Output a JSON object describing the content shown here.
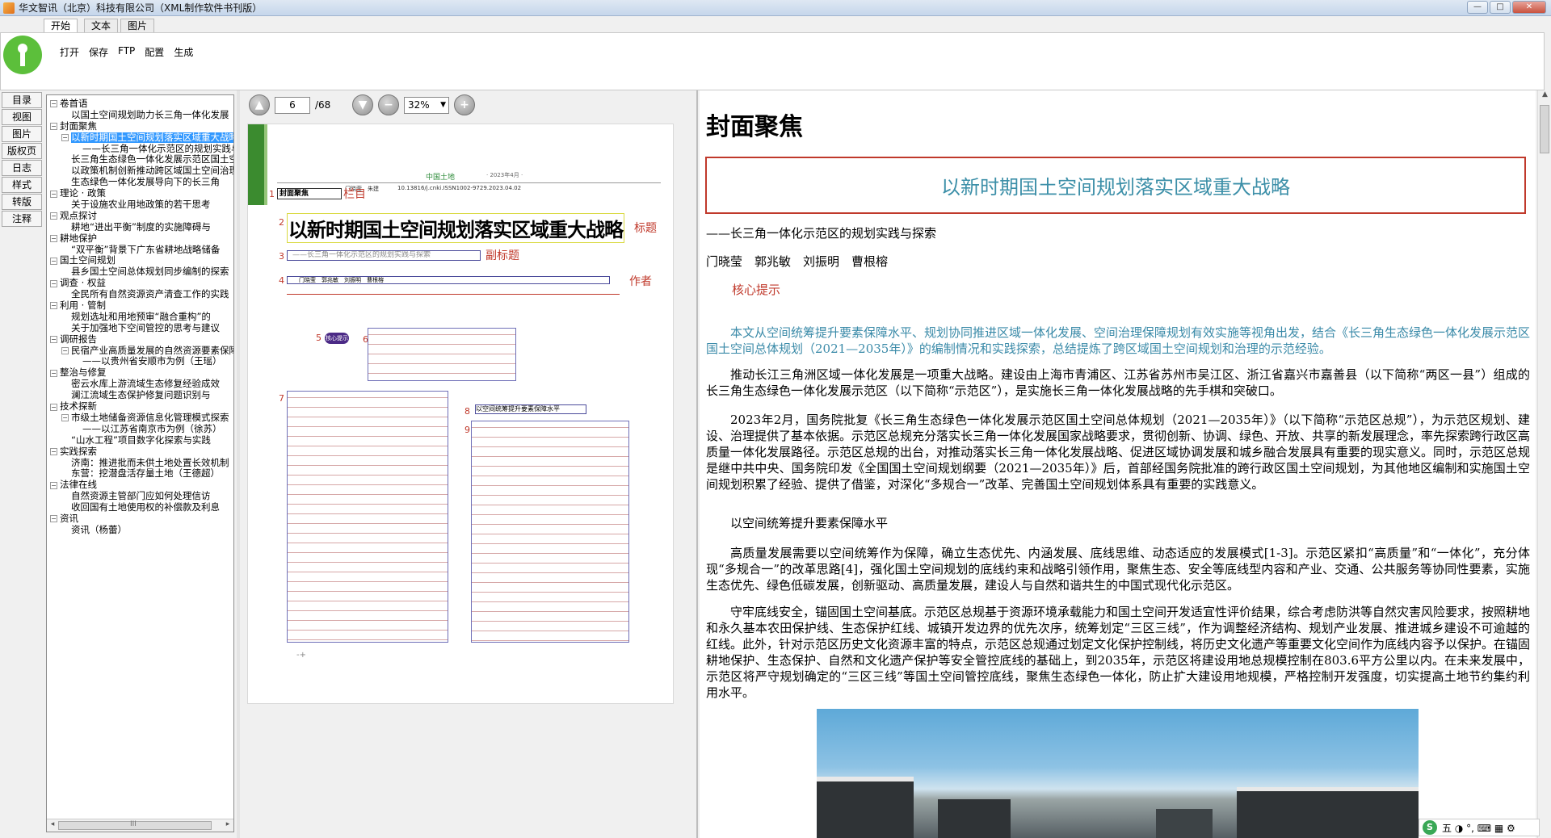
{
  "window": {
    "title": "华文智讯（北京）科技有限公司（XML制作软件书刊版）"
  },
  "ribbon": {
    "tabs": [
      "开始",
      "文本",
      "图片"
    ],
    "buttons": [
      "打开",
      "保存",
      "FTP",
      "配置",
      "生成"
    ]
  },
  "leftnav": [
    "目录",
    "视图",
    "图片",
    "版权页",
    "日志",
    "样式",
    "转版",
    "注释"
  ],
  "tree": [
    {
      "level": 0,
      "exp": "−",
      "text": "卷首语"
    },
    {
      "level": 1,
      "exp": "",
      "text": "以国土空间规划助力长三角一体化发展"
    },
    {
      "level": 0,
      "exp": "−",
      "text": "封面聚焦"
    },
    {
      "level": 1,
      "exp": "−",
      "text": "以新时期国土空间规划落实区域重大战略",
      "selected": true
    },
    {
      "level": 2,
      "exp": "",
      "text": "——长三角一体化示范区的规划实践与探索"
    },
    {
      "level": 1,
      "exp": "",
      "text": "长三角生态绿色一体化发展示范区国土空间总体规划"
    },
    {
      "level": 1,
      "exp": "",
      "text": "以政策机制创新推动跨区域国土空间治理"
    },
    {
      "level": 1,
      "exp": "",
      "text": "生态绿色一体化发展导向下的长三角"
    },
    {
      "level": 0,
      "exp": "−",
      "text": "理论 · 政策"
    },
    {
      "level": 1,
      "exp": "",
      "text": "关于设施农业用地政策的若干思考"
    },
    {
      "level": 0,
      "exp": "−",
      "text": "观点探讨"
    },
    {
      "level": 1,
      "exp": "",
      "text": "耕地“进出平衡”制度的实施障碍与"
    },
    {
      "level": 0,
      "exp": "−",
      "text": "耕地保护"
    },
    {
      "level": 1,
      "exp": "",
      "text": "“双平衡”背景下广东省耕地战略储备"
    },
    {
      "level": 0,
      "exp": "−",
      "text": "国土空间规划"
    },
    {
      "level": 1,
      "exp": "",
      "text": "县乡国土空间总体规划同步编制的探索"
    },
    {
      "level": 0,
      "exp": "−",
      "text": "调查 · 权益"
    },
    {
      "level": 1,
      "exp": "",
      "text": "全民所有自然资源资产清查工作的实践"
    },
    {
      "level": 0,
      "exp": "−",
      "text": "利用 · 管制"
    },
    {
      "level": 1,
      "exp": "",
      "text": "规划选址和用地预审“融合重构”的"
    },
    {
      "level": 1,
      "exp": "",
      "text": "关于加强地下空间管控的思考与建议"
    },
    {
      "level": 0,
      "exp": "−",
      "text": "调研报告"
    },
    {
      "level": 1,
      "exp": "−",
      "text": "民宿产业高质量发展的自然资源要素保障"
    },
    {
      "level": 2,
      "exp": "",
      "text": "——以贵州省安顺市为例（王瑶）"
    },
    {
      "level": 0,
      "exp": "−",
      "text": "整治与修复"
    },
    {
      "level": 1,
      "exp": "",
      "text": "密云水库上游流域生态修复经验成效"
    },
    {
      "level": 1,
      "exp": "",
      "text": "澜江流域生态保护修复问题识别与"
    },
    {
      "level": 0,
      "exp": "−",
      "text": "技术探新"
    },
    {
      "level": 1,
      "exp": "−",
      "text": "市级土地储备资源信息化管理模式探索"
    },
    {
      "level": 2,
      "exp": "",
      "text": "——以江苏省南京市为例（徐苏）"
    },
    {
      "level": 1,
      "exp": "",
      "text": "“山水工程”项目数字化探索与实践"
    },
    {
      "level": 0,
      "exp": "−",
      "text": "实践探索"
    },
    {
      "level": 1,
      "exp": "",
      "text": "济南：推进批而未供土地处置长效机制"
    },
    {
      "level": 1,
      "exp": "",
      "text": "东营：挖潜盘活存量土地（王德超）"
    },
    {
      "level": 0,
      "exp": "−",
      "text": "法律在线"
    },
    {
      "level": 1,
      "exp": "",
      "text": "自然资源主管部门应如何处理信访"
    },
    {
      "level": 1,
      "exp": "",
      "text": "收回国有土地使用权的补偿款及利息"
    },
    {
      "level": 0,
      "exp": "−",
      "text": "资讯"
    },
    {
      "level": 1,
      "exp": "",
      "text": "资讯（杨蕾）"
    }
  ],
  "tree_scroll": {
    "thumb_label": "III",
    "left": "◂",
    "right": "▸"
  },
  "pdf": {
    "current_page": "6",
    "total": "/68",
    "zoom": "32%",
    "btn_prev": "▲",
    "btn_next": "▼",
    "btn_zoomout": "−",
    "btn_zoomin": "+",
    "journal": "中国土地",
    "issue": "· 2023年4月 ·",
    "authors_small": "门晓莹　朱建",
    "doi": "10.13816/j.cnki.ISSN1002-9729.2023.04.02",
    "frame_label": "封面聚焦",
    "labels": {
      "lanmu": "栏目",
      "biaoti": "标题",
      "fubiaoti": "副标题",
      "zuozhe": "作者"
    },
    "nums": [
      "1",
      "2",
      "3",
      "4",
      "5",
      "6",
      "7",
      "8",
      "9"
    ],
    "big_title": "以新时期国土空间规划落实区域重大战略",
    "sub": "——长三角一体化示范区的规划实践与探索",
    "authors": "门晓莹　郭兆敏　刘振明　曹根榕",
    "core": "核心提示",
    "section8": "以空间统筹提升要素保障水平",
    "plus": "-+"
  },
  "content": {
    "section": "封面聚焦",
    "title": "以新时期国土空间规划落实区域重大战略",
    "subtitle": "——长三角一体化示范区的规划实践与探索",
    "authors": "门晓莹　郭兆敏　刘振明　曹根榕",
    "core_label": "核心提示",
    "abstract": "本文从空间统筹提升要素保障水平、规划协同推进区域一体化发展、空间治理保障规划有效实施等视角出发，结合《长三角生态绿色一体化发展示范区国土空间总体规划（2021—2035年）》的编制情况和实践探索，总结提炼了跨区域国土空间规划和治理的示范经验。",
    "paragraphs": [
      "推动长江三角洲区域一体化发展是一项重大战略。建设由上海市青浦区、江苏省苏州市吴江区、浙江省嘉兴市嘉善县（以下简称“两区一县”）组成的长三角生态绿色一体化发展示范区（以下简称“示范区”），是实施长三角一体化发展战略的先手棋和突破口。",
      "2023年2月，国务院批复《长三角生态绿色一体化发展示范区国土空间总体规划（2021—2035年）》（以下简称“示范区总规”），为示范区规划、建设、治理提供了基本依据。示范区总规充分落实长三角一体化发展国家战略要求，贯彻创新、协调、绿色、开放、共享的新发展理念，率先探索跨行政区高质量一体化发展路径。示范区总规的出台，对推动落实长三角一体化发展战略、促进区域协调发展和城乡融合发展具有重要的现实意义。同时，示范区总规是继中共中央、国务院印发《全国国土空间规划纲要（2021—2035年）》后，首部经国务院批准的跨行政区国土空间规划，为其他地区编制和实施国土空间规划积累了经验、提供了借鉴，对深化“多规合一”改革、完善国土空间规划体系具有重要的实践意义。",
      "以空间统筹提升要素保障水平",
      "高质量发展需要以空间统筹作为保障，确立生态优先、内涵发展、底线思维、动态适应的发展模式[1-3]。示范区紧扣“高质量”和“一体化”，充分体现“多规合一”的改革思路[4]，强化国土空间规划的底线约束和战略引领作用，聚焦生态、安全等底线型内容和产业、交通、公共服务等协同性要素，实施生态优先、绿色低碳发展，创新驱动、高质量发展，建设人与自然和谐共生的中国式现代化示范区。",
      "守牢底线安全，锚固国土空间基底。示范区总规基于资源环境承载能力和国土空间开发适宜性评价结果，综合考虑防洪等自然灾害风险要求，按照耕地和永久基本农田保护线、生态保护红线、城镇开发边界的优先次序，统筹划定“三区三线”，作为调整经济结构、规划产业发展、推进城乡建设不可逾越的红线。此外，针对示范区历史文化资源丰富的特点，示范区总规通过划定文化保护控制线，将历史文化遗产等重要文化空间作为底线内容予以保护。在锚固耕地保护、生态保护、自然和文化遗产保护等安全管控底线的基础上，到2035年，示范区将建设用地总规模控制在803.6平方公里以内。在未来发展中，示范区将严守规划确定的“三区三线”等国土空间管控底线，聚焦生态绿色一体化，防止扩大建设用地规模，严格控制开发强度，切实提高土地节约集约利用水平。"
    ]
  },
  "ime": {
    "logo": "S",
    "items": "五 ◑ °, ⌨ ▦ ⚙"
  },
  "window_buttons": {
    "min": "—",
    "max": "□",
    "close": "✕"
  }
}
